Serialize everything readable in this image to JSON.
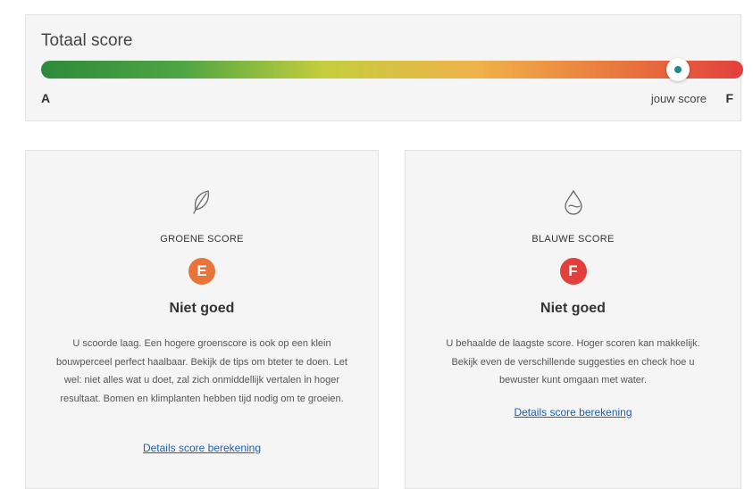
{
  "total": {
    "title": "Totaal score",
    "label_a": "A",
    "label_f": "F",
    "your_score_label": "jouw score",
    "marker_fraction": 0.907
  },
  "cards": [
    {
      "icon": "leaf-icon",
      "category": "GROENE SCORE",
      "grade": "E",
      "grade_color": "#e7743a",
      "rating": "Niet goed",
      "description": "U scoorde laag. Een hogere groenscore is ook op een klein bouwperceel perfect haalbaar. Bekijk de tips om bteter te doen. Let wel: niet alles wat u doet, zal zich onmiddellijk vertalen in hoger resultaat. Bomen en klimplanten hebben tijd nodig om te groeien.",
      "link": "Details score berekening"
    },
    {
      "icon": "water-drop-icon",
      "category": "BLAUWE SCORE",
      "grade": "F",
      "grade_color": "#e2403d",
      "rating": "Niet goed",
      "description": "U behaalde de laagste score. Hoger scoren kan makkelijk. Bekijk even de verschillende suggesties en check hoe u bewuster kunt omgaan met water.",
      "link": "Details score berekening"
    }
  ]
}
